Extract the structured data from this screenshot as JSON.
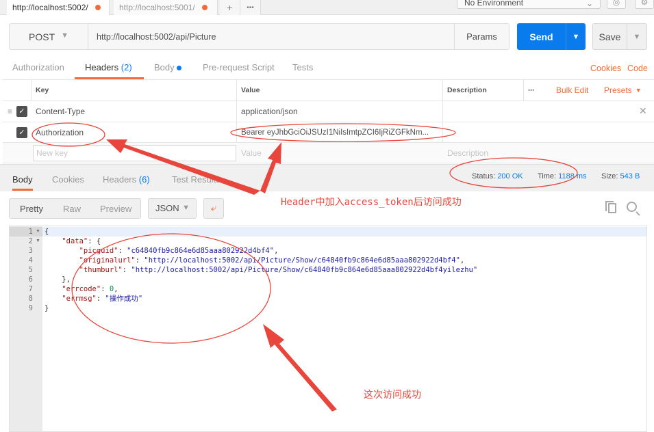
{
  "tabs": [
    {
      "label": "http://localhost:5002/",
      "active": true
    },
    {
      "label": "http://localhost:5001/",
      "active": false
    }
  ],
  "tab_controls": {
    "add": "+",
    "more": "•••"
  },
  "environment": {
    "selected": "No Environment"
  },
  "request": {
    "method": "POST",
    "url": "http://localhost:5002/api/Picture",
    "params_label": "Params",
    "send_label": "Send",
    "save_label": "Save"
  },
  "request_tabs": [
    {
      "label": "Authorization"
    },
    {
      "label": "Headers",
      "count": "(2)",
      "active": true
    },
    {
      "label": "Body",
      "has_dot": true
    },
    {
      "label": "Pre-request Script"
    },
    {
      "label": "Tests"
    }
  ],
  "request_links": {
    "cookies": "Cookies",
    "code": "Code"
  },
  "headers_table": {
    "columns": {
      "key": "Key",
      "value": "Value",
      "description": "Description"
    },
    "more": "•••",
    "bulk_edit": "Bulk Edit",
    "presets": "Presets",
    "rows": [
      {
        "key": "Content-Type",
        "value": "application/json",
        "checked": true
      },
      {
        "key": "Authorization",
        "value": "Bearer eyJhbGciOiJSUzI1NiIsImtpZCI6IjRiZGFkNm...",
        "checked": true
      }
    ],
    "placeholders": {
      "key": "New key",
      "value": "Value",
      "description": "Description"
    }
  },
  "response_tabs": [
    {
      "label": "Body",
      "active": true
    },
    {
      "label": "Cookies"
    },
    {
      "label": "Headers",
      "count": "(6)"
    },
    {
      "label": "Test Results"
    }
  ],
  "response_status": {
    "status_label": "Status:",
    "status_value": "200 OK",
    "time_label": "Time:",
    "time_value": "1188 ms",
    "size_label": "Size:",
    "size_value": "543 B"
  },
  "view_options": {
    "pretty": "Pretty",
    "raw": "Raw",
    "preview": "Preview",
    "format": "JSON"
  },
  "code_lines": [
    {
      "n": "1",
      "fold": true
    },
    {
      "n": "2",
      "fold": true
    },
    {
      "n": "3"
    },
    {
      "n": "4"
    },
    {
      "n": "5"
    },
    {
      "n": "6"
    },
    {
      "n": "7"
    },
    {
      "n": "8"
    },
    {
      "n": "9"
    }
  ],
  "response_body": {
    "open": "{",
    "data_key": "\"data\"",
    "picguid_key": "\"picguid\"",
    "picguid": "\"c64840fb9c864e6d85aaa802922d4bf4\"",
    "originalurl_key": "\"originalurl\"",
    "originalurl": "\"http://localhost:5002/api/Picture/Show/c64840fb9c864e6d85aaa802922d4bf4\"",
    "thumburl_key": "\"thumburl\"",
    "thumburl": "\"http://localhost:5002/api/Picture/Show/c64840fb9c864e6d85aaa802922d4bf4yilezhu\"",
    "errcode_key": "\"errcode\"",
    "errcode": "0",
    "errmsg_key": "\"errmsg\"",
    "errmsg": "\"操作成功\"",
    "close": "}"
  },
  "annotations": {
    "header_note": "Header中加入access_token后访问成功",
    "success_note": "这次访问成功",
    "color": "#e8463c"
  },
  "colors": {
    "accent": "#f26b3a",
    "primary": "#097bed"
  }
}
